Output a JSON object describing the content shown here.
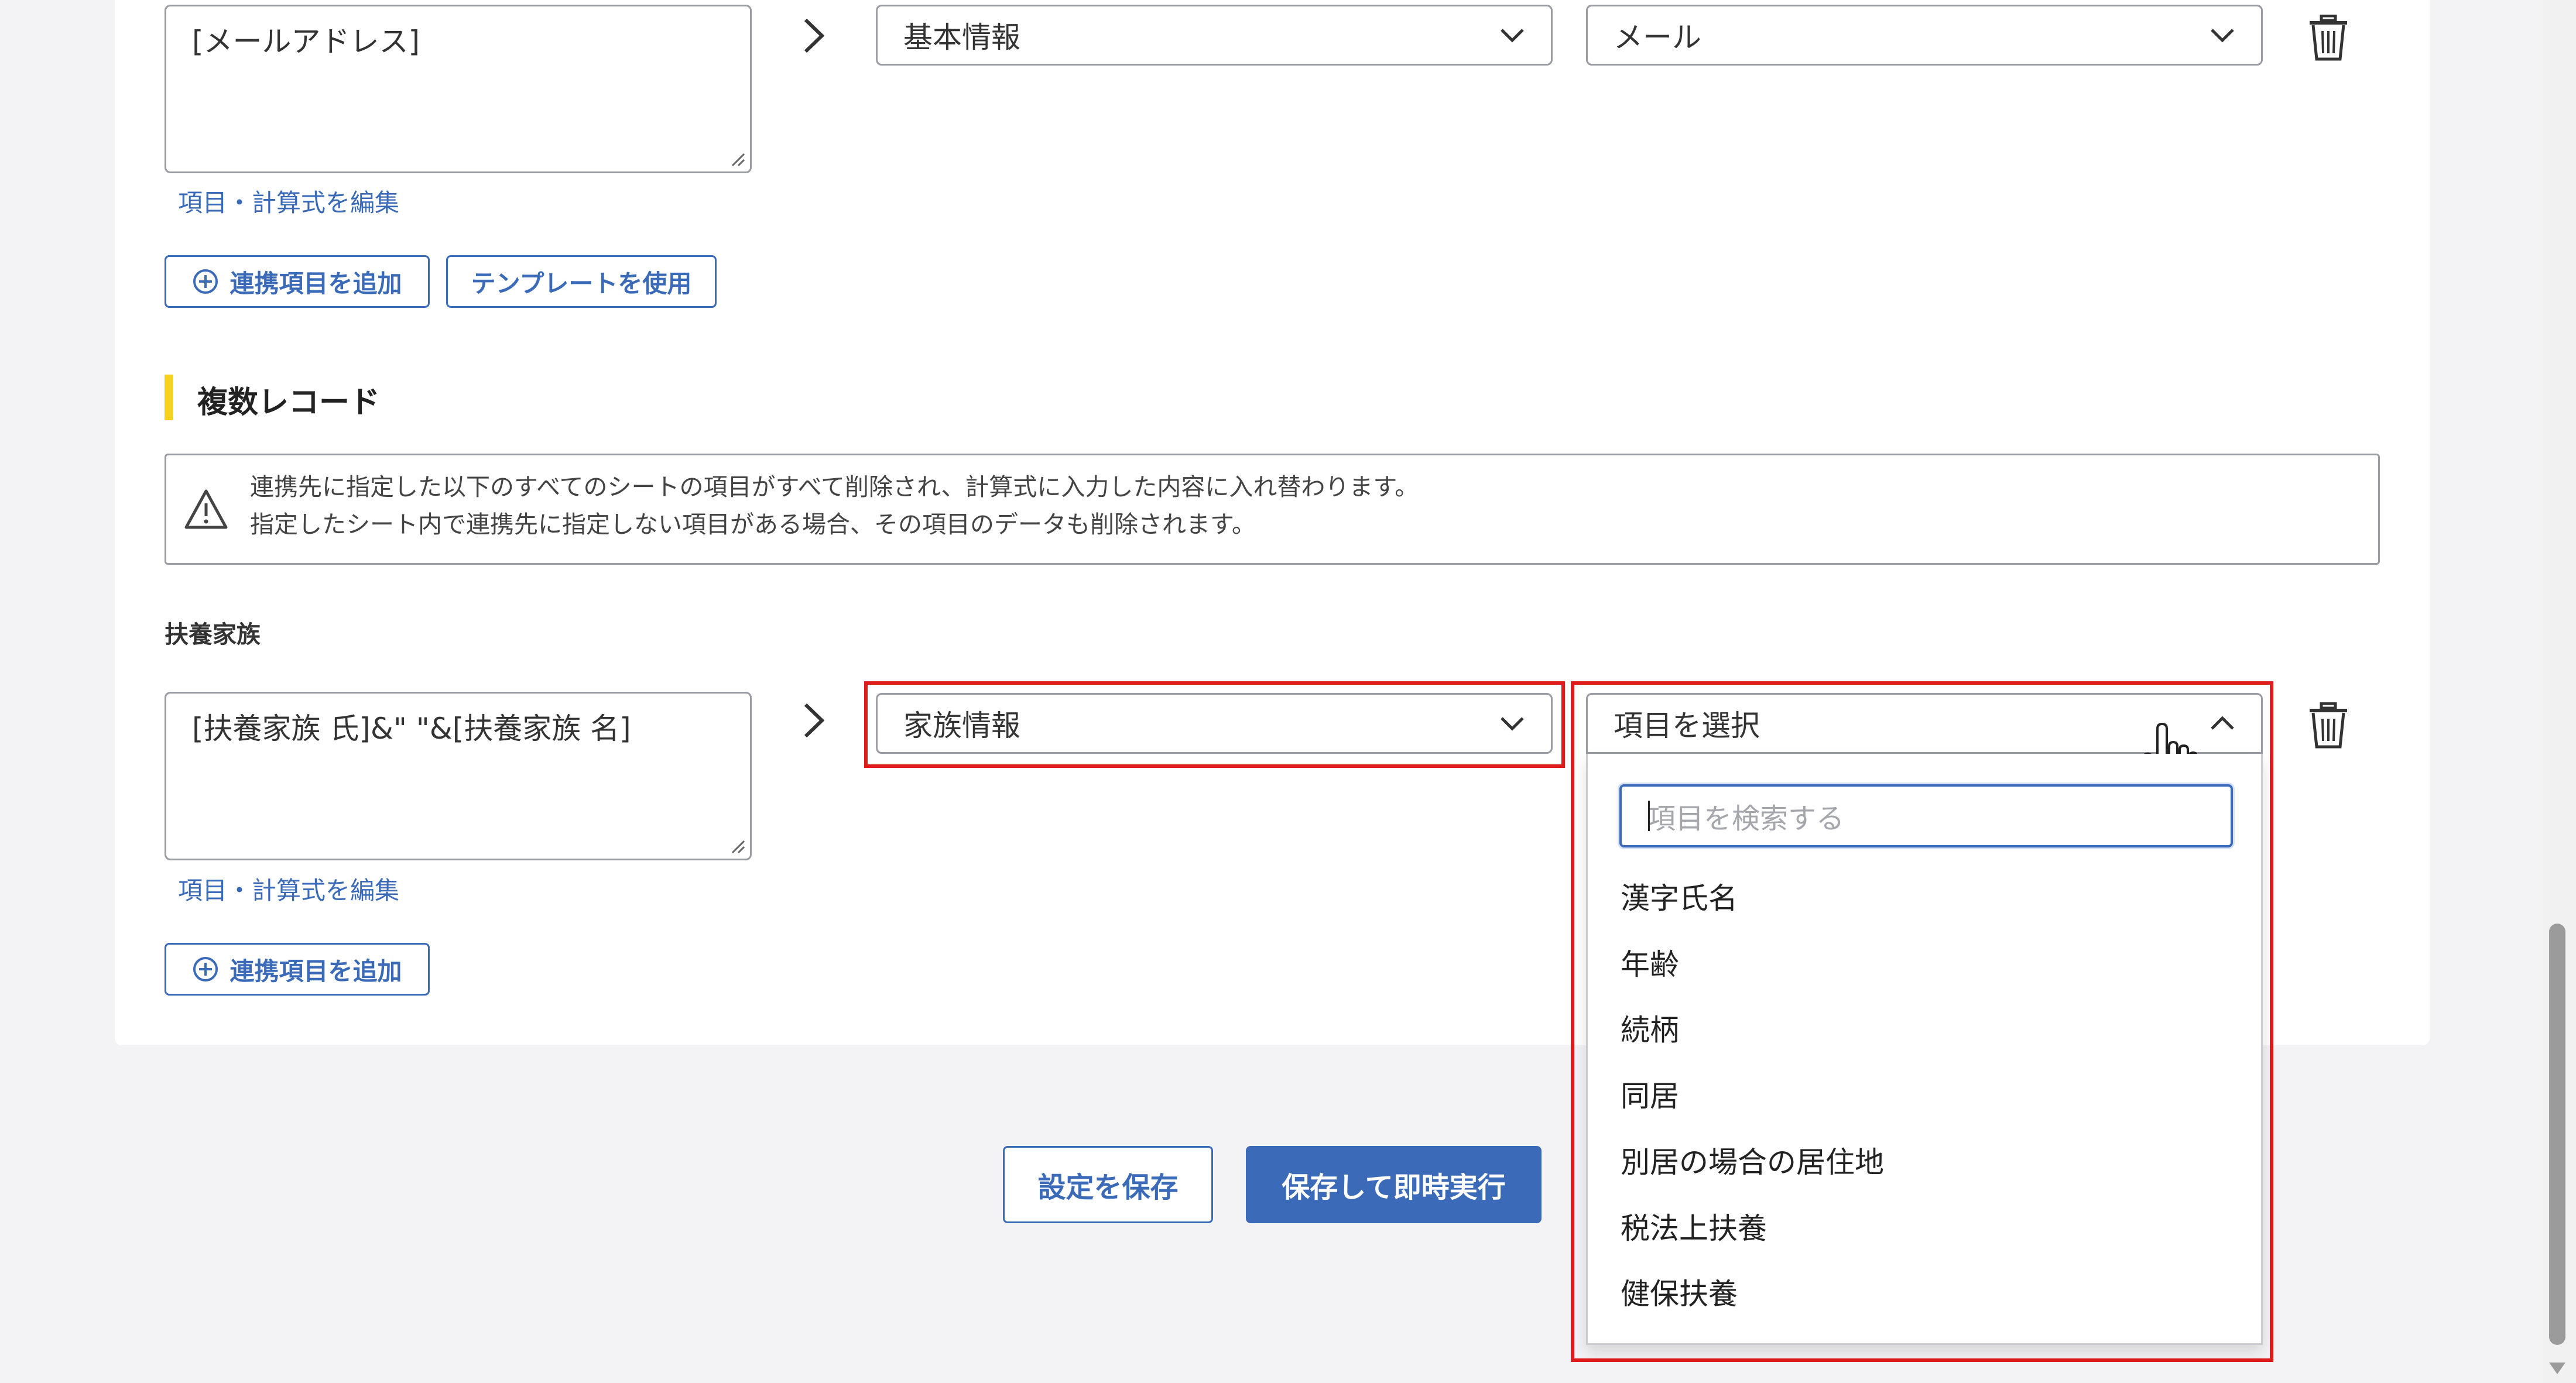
{
  "mapping_top": {
    "formula_value": "[メールアドレス]",
    "edit_link": "項目・計算式を編集",
    "sheet_select": "基本情報",
    "field_select": "メール"
  },
  "buttons": {
    "add_field": "連携項目を追加",
    "use_template": "テンプレートを使用",
    "save_settings": "設定を保存",
    "save_and_run": "保存して即時実行"
  },
  "multi_record": {
    "title": "複数レコード",
    "notice_lines": [
      "連携先に指定した以下のすべてのシートの項目がすべて削除され、計算式に入力した内容に入れ替わります。",
      "指定したシート内で連携先に指定しない項目がある場合、その項目のデータも削除されます。"
    ]
  },
  "dependents": {
    "label": "扶養家族",
    "formula_value": "[扶養家族 氏]&\" \"&[扶養家族 名]",
    "edit_link": "項目・計算式を編集",
    "sheet_select": "家族情報",
    "field_select": "項目を選択",
    "search_placeholder": "項目を検索する",
    "options": [
      "漢字氏名",
      "年齢",
      "続柄",
      "同居",
      "別居の場合の居住地",
      "税法上扶養",
      "健保扶養"
    ]
  },
  "colors": {
    "accent": "#3a6ab8",
    "highlight": "#e01b1b",
    "section_bar": "#f5d11d"
  }
}
